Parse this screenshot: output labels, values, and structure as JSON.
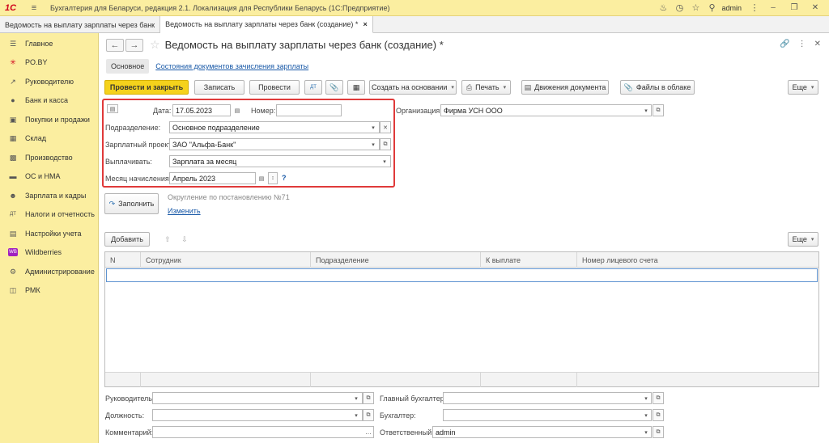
{
  "window": {
    "title": "Бухгалтерия для Беларуси, редакция 2.1. Локализация для Республики Беларусь  (1С:Предприятие)",
    "user": "admin"
  },
  "tabs": [
    {
      "label": "Ведомость на выплату зарплаты через банк"
    },
    {
      "label": "Ведомость на выплату зарплаты через банк (создание) *",
      "close": "×"
    }
  ],
  "sidebar": {
    "items": [
      {
        "label": "Главное",
        "icon": "menu-icon"
      },
      {
        "label": "PO.BY",
        "icon": "asterisk-icon"
      },
      {
        "label": "Руководителю",
        "icon": "trend-icon"
      },
      {
        "label": "Банк и касса",
        "icon": "coin-icon"
      },
      {
        "label": "Покупки и продажи",
        "icon": "cart-icon"
      },
      {
        "label": "Склад",
        "icon": "warehouse-icon"
      },
      {
        "label": "Производство",
        "icon": "factory-icon"
      },
      {
        "label": "ОС и НМА",
        "icon": "truck-icon"
      },
      {
        "label": "Зарплата и кадры",
        "icon": "person-icon"
      },
      {
        "label": "Налоги и отчетность",
        "icon": "dt-kt-icon"
      },
      {
        "label": "Настройки учета",
        "icon": "book-icon"
      },
      {
        "label": "Wildberries",
        "icon": "wb-icon"
      },
      {
        "label": "Администрирование",
        "icon": "gear-icon"
      },
      {
        "label": "РМК",
        "icon": "register-icon"
      }
    ]
  },
  "document": {
    "title": "Ведомость на выплату зарплаты через банк (создание) *",
    "subtab_active": "Основное",
    "subtab_link": "Состояния документов зачисления зарплаты"
  },
  "toolbar": {
    "post_close": "Провести и закрыть",
    "save": "Записать",
    "post": "Провести",
    "create_based": "Создать на основании",
    "print": "Печать",
    "movements": "Движения документа",
    "cloud_files": "Файлы в облаке",
    "more": "Еще"
  },
  "form": {
    "date_label": "Дата:",
    "date_value": "17.05.2023",
    "number_label": "Номер:",
    "number_value": "",
    "org_label": "Организация:",
    "org_value": "Фирма УСН ООО",
    "division_label": "Подразделение:",
    "division_value": "Основное подразделение",
    "project_label": "Зарплатный проект:",
    "project_value": "ЗАО \"Альфа-Банк\"",
    "pay_label": "Выплачивать:",
    "pay_value": "Зарплата за месяц",
    "month_label": "Месяц начисления:",
    "month_value": "Апрель 2023",
    "help": "?"
  },
  "fill": {
    "button": "Заполнить",
    "rounding": "Округление по постановлению №71",
    "change": "Изменить"
  },
  "table": {
    "add": "Добавить",
    "more": "Еще",
    "columns": [
      "N",
      "Сотрудник",
      "Подразделение",
      "К выплате",
      "Номер лицевого счета"
    ]
  },
  "footer": {
    "head_label": "Руководитель:",
    "head_value": "",
    "position_label": "Должность:",
    "position_value": "",
    "comment_label": "Комментарий:",
    "comment_value": "",
    "chief_acc_label": "Главный бухгалтер:",
    "chief_acc_value": "",
    "accountant_label": "Бухгалтер:",
    "accountant_value": "",
    "responsible_label": "Ответственный:",
    "responsible_value": "admin"
  }
}
